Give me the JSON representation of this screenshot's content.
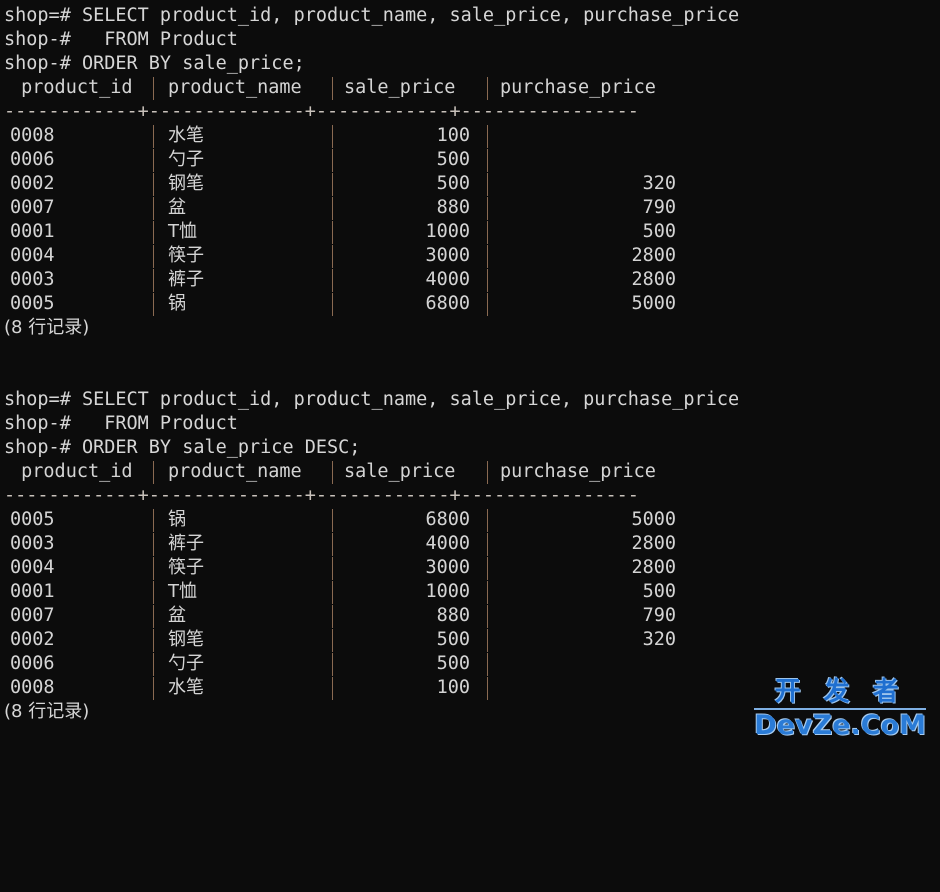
{
  "terminal": {
    "background_color": "#0c0c0c",
    "text_color": "#d6d6d6",
    "separator_color": "#8a6a52"
  },
  "block1": {
    "prompt_lines": [
      "shop=# SELECT product_id, product_name, sale_price, purchase_price",
      "shop-#   FROM Product",
      "shop-# ORDER BY sale_price;"
    ],
    "headers": {
      "product_id": " product_id",
      "product_name": "product_name",
      "sale_price": "sale_price",
      "purchase_price": "purchase_price"
    },
    "separator": "------------+--------------+------------+----------------",
    "rows": [
      {
        "product_id": "0008",
        "product_name": "水笔",
        "sale_price": "100",
        "purchase_price": ""
      },
      {
        "product_id": "0006",
        "product_name": "勺子",
        "sale_price": "500",
        "purchase_price": ""
      },
      {
        "product_id": "0002",
        "product_name": "钢笔",
        "sale_price": "500",
        "purchase_price": "320"
      },
      {
        "product_id": "0007",
        "product_name": "盆",
        "sale_price": "880",
        "purchase_price": "790"
      },
      {
        "product_id": "0001",
        "product_name": "T恤",
        "sale_price": "1000",
        "purchase_price": "500"
      },
      {
        "product_id": "0004",
        "product_name": "筷子",
        "sale_price": "3000",
        "purchase_price": "2800"
      },
      {
        "product_id": "0003",
        "product_name": "裤子",
        "sale_price": "4000",
        "purchase_price": "2800"
      },
      {
        "product_id": "0005",
        "product_name": "锅",
        "sale_price": "6800",
        "purchase_price": "5000"
      }
    ],
    "row_count_text": "(8 行记录)"
  },
  "block2": {
    "prompt_lines": [
      "shop=# SELECT product_id, product_name, sale_price, purchase_price",
      "shop-#   FROM Product",
      "shop-# ORDER BY sale_price DESC;"
    ],
    "headers": {
      "product_id": " product_id",
      "product_name": "product_name",
      "sale_price": "sale_price",
      "purchase_price": "purchase_price"
    },
    "separator": "------------+--------------+------------+----------------",
    "rows": [
      {
        "product_id": "0005",
        "product_name": "锅",
        "sale_price": "6800",
        "purchase_price": "5000"
      },
      {
        "product_id": "0003",
        "product_name": "裤子",
        "sale_price": "4000",
        "purchase_price": "2800"
      },
      {
        "product_id": "0004",
        "product_name": "筷子",
        "sale_price": "3000",
        "purchase_price": "2800"
      },
      {
        "product_id": "0001",
        "product_name": "T恤",
        "sale_price": "1000",
        "purchase_price": "500"
      },
      {
        "product_id": "0007",
        "product_name": "盆",
        "sale_price": "880",
        "purchase_price": "790"
      },
      {
        "product_id": "0002",
        "product_name": "钢笔",
        "sale_price": "500",
        "purchase_price": "320"
      },
      {
        "product_id": "0006",
        "product_name": "勺子",
        "sale_price": "500",
        "purchase_price": ""
      },
      {
        "product_id": "0008",
        "product_name": "水笔",
        "sale_price": "100",
        "purchase_price": ""
      }
    ],
    "row_count_text": "(8 行记录)"
  },
  "watermark": {
    "line1": "开 发 者",
    "line2": "DevZe.CoM",
    "color": "#2a7bd6"
  }
}
